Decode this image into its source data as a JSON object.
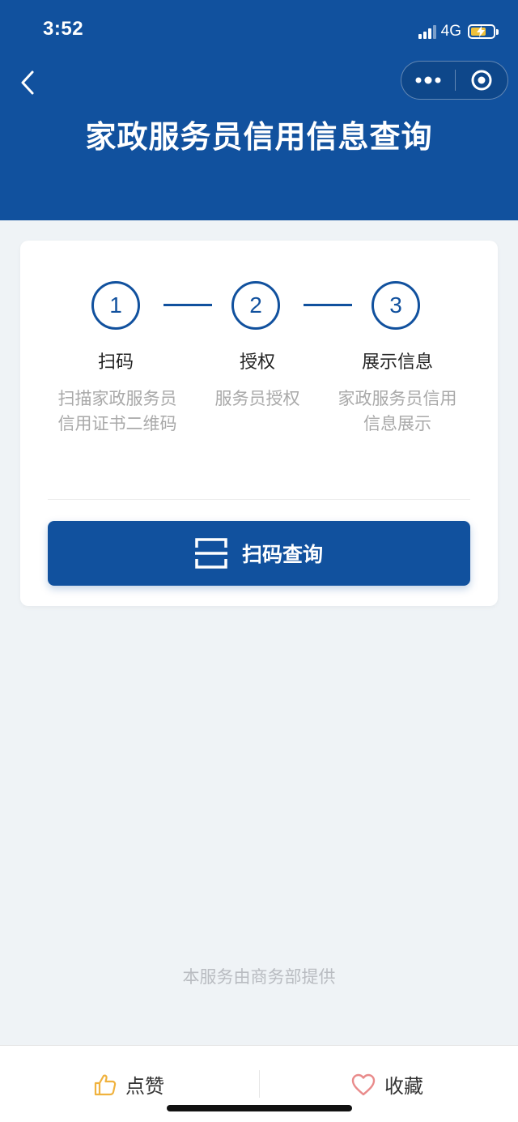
{
  "status_bar": {
    "time": "3:52",
    "network": "4G"
  },
  "nav": {
    "title": "家政服务员信用信息查询"
  },
  "steps": [
    {
      "number": "1",
      "title": "扫码",
      "desc_line1": "扫描家政服务员",
      "desc_line2": "信用证书二维码"
    },
    {
      "number": "2",
      "title": "授权",
      "desc_line1": "服务员授权",
      "desc_line2": ""
    },
    {
      "number": "3",
      "title": "展示信息",
      "desc_line1": "家政服务员信用",
      "desc_line2": "信息展示"
    }
  ],
  "scan_button": {
    "label": "扫码查询",
    "icon": "scan-icon"
  },
  "footer": {
    "provider": "本服务由商务部提供"
  },
  "bottom_bar": {
    "like_label": "点赞",
    "like_icon": "thumbs-up-icon",
    "favorite_label": "收藏",
    "favorite_icon": "heart-icon"
  },
  "colors": {
    "primary": "#11519e",
    "background": "#eff3f6",
    "like_icon": "#f0b23e",
    "favorite_icon": "#e98b8b"
  }
}
